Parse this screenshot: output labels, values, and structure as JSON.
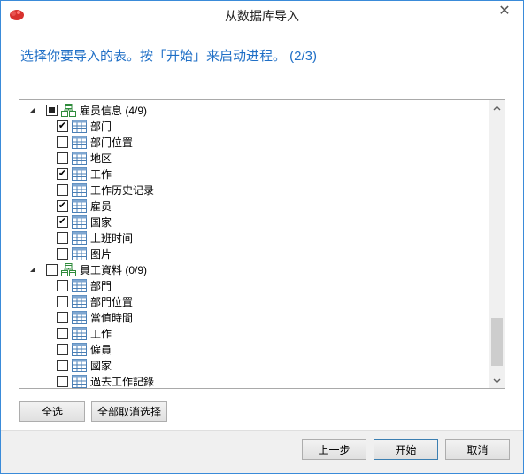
{
  "window": {
    "title": "从数据库导入",
    "close_glyph": "✕"
  },
  "subtitle": "选择你要导入的表。按「开始」来启动进程。 (2/3)",
  "tree": {
    "groups": [
      {
        "label": "雇员信息 (4/9)",
        "expanded": true,
        "state": "partial",
        "items": [
          {
            "label": "部门",
            "checked": true
          },
          {
            "label": "部门位置",
            "checked": false
          },
          {
            "label": "地区",
            "checked": false
          },
          {
            "label": "工作",
            "checked": true
          },
          {
            "label": "工作历史记录",
            "checked": false
          },
          {
            "label": "雇员",
            "checked": true
          },
          {
            "label": "国家",
            "checked": true
          },
          {
            "label": "上班时间",
            "checked": false
          },
          {
            "label": "图片",
            "checked": false
          }
        ]
      },
      {
        "label": "員工資料 (0/9)",
        "expanded": true,
        "state": "unchecked",
        "items": [
          {
            "label": "部門",
            "checked": false
          },
          {
            "label": "部門位置",
            "checked": false
          },
          {
            "label": "當值時間",
            "checked": false
          },
          {
            "label": "工作",
            "checked": false
          },
          {
            "label": "僱員",
            "checked": false
          },
          {
            "label": "國家",
            "checked": false
          },
          {
            "label": "過去工作記錄",
            "checked": false
          }
        ]
      }
    ]
  },
  "buttons": {
    "select_all": "全选",
    "deselect_all": "全部取消选择",
    "prev": "上一步",
    "start": "开始",
    "cancel": "取消"
  },
  "icons": {
    "app": "app-logo-icon",
    "group": "database-group-icon",
    "table": "table-icon",
    "expander": "expand-triangle-icon",
    "scroll_up": "chevron-up-icon",
    "scroll_down": "chevron-down-icon"
  },
  "colors": {
    "accent": "#1f6fc6",
    "border": "#3a8bd9"
  }
}
